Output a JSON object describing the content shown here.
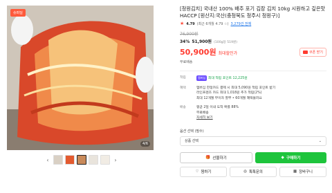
{
  "gallery": {
    "badge": "슈퍼딜",
    "counter": "4/6",
    "prev_arrow": "‹",
    "next_arrow": "›",
    "thumbs": [
      "#d9d0c4",
      "#e35a2f",
      "#c98a5a",
      "#e9e4dc",
      "#f1ece4"
    ]
  },
  "product": {
    "title": "[청원김치] 국내산 100% 배추 포기 김장 김치 10kg 시원하고 깊은맛 HACCP [원산지:국산(충청북도 청주시 청원구)]",
    "rating_score": "4.79",
    "rating_meta": "(최근 6개월 4.79 ☆)",
    "review_count": "3,279건 전체",
    "original_price": "76,900원",
    "discount_pct": "34%",
    "discount_price": "51,900원",
    "unit_note": "(100g당 519원)",
    "sale_price": "50,900원",
    "sale_label": "최대할인가",
    "coupon_label": "쿠폰 받기",
    "shipping": "무료배송"
  },
  "info": {
    "point_key": "적립",
    "point_badge": "멤버십",
    "point_text": "최대 적립 포인트 12,225원",
    "benefit_key": "혜택",
    "benefit_lines": [
      "멤버십 한정카드 결제 시 최대 5,090원 적립 포인트 받기",
      "라인프렌즈 카드 최대 1,018원 추가 적립(2%)",
      "최대 12개월 무이자 할부 • 60개월 혜택불러요"
    ],
    "delivery_key": "배송",
    "delivery_lines": [
      "평균 2일 이내 도착 확률 88%",
      "무료배송"
    ],
    "delivery_link": "자세히 보기"
  },
  "options": {
    "label": "옵션 선택 (필수)",
    "select_placeholder": "상품 선택"
  },
  "actions": {
    "gift_label": "선물하기",
    "buy_label": "구매하기",
    "like_label": "찜하기",
    "inquiry_label": "톡톡문의",
    "cart_label": "장바구니"
  },
  "colors": {
    "accent_red": "#ff3b30",
    "buy_green": "#1ec43c"
  }
}
